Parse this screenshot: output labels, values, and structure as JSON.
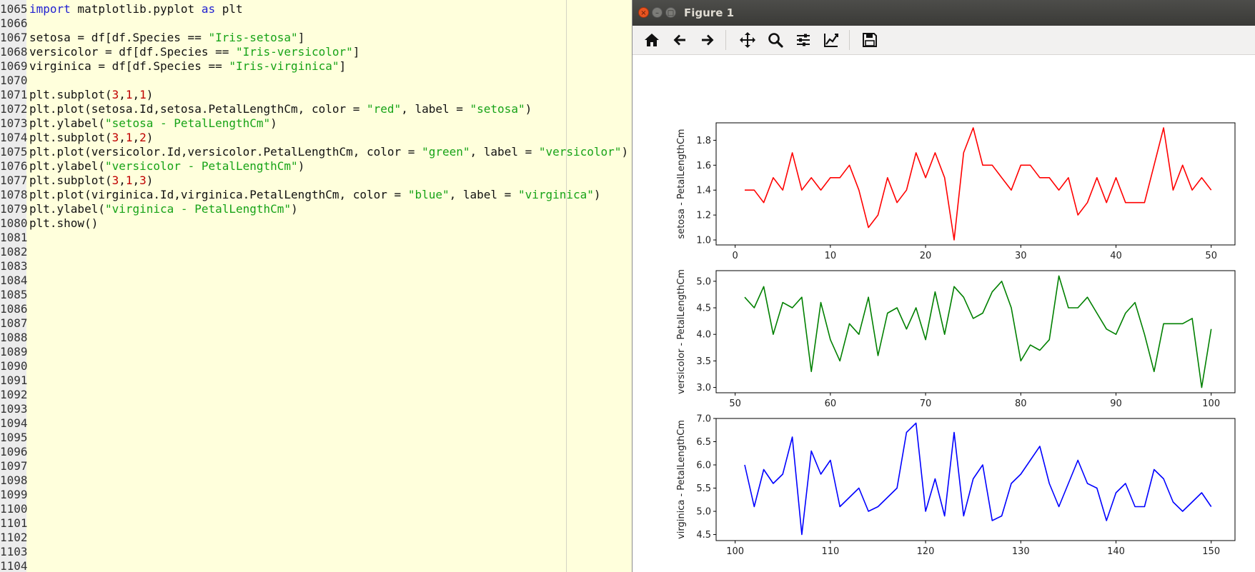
{
  "editor": {
    "lines": [
      {
        "n": "1065",
        "tokens": [
          {
            "t": "import",
            "c": "kw"
          },
          {
            "t": " matplotlib.pyplot "
          },
          {
            "t": "as",
            "c": "kw"
          },
          {
            "t": " plt"
          }
        ]
      },
      {
        "n": "1066",
        "tokens": []
      },
      {
        "n": "1067",
        "tokens": [
          {
            "t": "setosa = df[df.Species == "
          },
          {
            "t": "\"Iris-setosa\"",
            "c": "str"
          },
          {
            "t": "]"
          }
        ]
      },
      {
        "n": "1068",
        "tokens": [
          {
            "t": "versicolor = df[df.Species == "
          },
          {
            "t": "\"Iris-versicolor\"",
            "c": "str"
          },
          {
            "t": "]"
          }
        ]
      },
      {
        "n": "1069",
        "tokens": [
          {
            "t": "virginica = df[df.Species == "
          },
          {
            "t": "\"Iris-virginica\"",
            "c": "str"
          },
          {
            "t": "]"
          }
        ]
      },
      {
        "n": "1070",
        "tokens": []
      },
      {
        "n": "1071",
        "tokens": [
          {
            "t": "plt.subplot("
          },
          {
            "t": "3",
            "c": "num"
          },
          {
            "t": ","
          },
          {
            "t": "1",
            "c": "num"
          },
          {
            "t": ","
          },
          {
            "t": "1",
            "c": "num"
          },
          {
            "t": ")"
          }
        ]
      },
      {
        "n": "1072",
        "tokens": [
          {
            "t": "plt.plot(setosa.Id,setosa.PetalLengthCm, color = "
          },
          {
            "t": "\"red\"",
            "c": "str"
          },
          {
            "t": ", label = "
          },
          {
            "t": "\"setosa\"",
            "c": "str"
          },
          {
            "t": ")"
          }
        ]
      },
      {
        "n": "1073",
        "tokens": [
          {
            "t": "plt.ylabel("
          },
          {
            "t": "\"setosa - PetalLengthCm\"",
            "c": "str"
          },
          {
            "t": ")"
          }
        ]
      },
      {
        "n": "1074",
        "tokens": [
          {
            "t": "plt.subplot("
          },
          {
            "t": "3",
            "c": "num"
          },
          {
            "t": ","
          },
          {
            "t": "1",
            "c": "num"
          },
          {
            "t": ","
          },
          {
            "t": "2",
            "c": "num"
          },
          {
            "t": ")"
          }
        ]
      },
      {
        "n": "1075",
        "tokens": [
          {
            "t": "plt.plot(versicolor.Id,versicolor.PetalLengthCm, color = "
          },
          {
            "t": "\"green\"",
            "c": "str"
          },
          {
            "t": ", label = "
          },
          {
            "t": "\"versicolor\"",
            "c": "str"
          },
          {
            "t": ")"
          }
        ]
      },
      {
        "n": "1076",
        "tokens": [
          {
            "t": "plt.ylabel("
          },
          {
            "t": "\"versicolor - PetalLengthCm\"",
            "c": "str"
          },
          {
            "t": ")"
          }
        ]
      },
      {
        "n": "1077",
        "tokens": [
          {
            "t": "plt.subplot("
          },
          {
            "t": "3",
            "c": "num"
          },
          {
            "t": ","
          },
          {
            "t": "1",
            "c": "num"
          },
          {
            "t": ","
          },
          {
            "t": "3",
            "c": "num"
          },
          {
            "t": ")"
          }
        ]
      },
      {
        "n": "1078",
        "tokens": [
          {
            "t": "plt.plot(virginica.Id,virginica.PetalLengthCm, color = "
          },
          {
            "t": "\"blue\"",
            "c": "str"
          },
          {
            "t": ", label = "
          },
          {
            "t": "\"virginica\"",
            "c": "str"
          },
          {
            "t": ")"
          }
        ]
      },
      {
        "n": "1079",
        "tokens": [
          {
            "t": "plt.ylabel("
          },
          {
            "t": "\"virginica - PetalLengthCm\"",
            "c": "str"
          },
          {
            "t": ")"
          }
        ]
      },
      {
        "n": "1080",
        "tokens": [
          {
            "t": "plt.show()"
          }
        ]
      },
      {
        "n": "1081",
        "tokens": []
      },
      {
        "n": "1082",
        "tokens": []
      },
      {
        "n": "1083",
        "tokens": []
      },
      {
        "n": "1084",
        "tokens": []
      },
      {
        "n": "1085",
        "tokens": []
      },
      {
        "n": "1086",
        "tokens": []
      },
      {
        "n": "1087",
        "tokens": []
      },
      {
        "n": "1088",
        "tokens": []
      },
      {
        "n": "1089",
        "tokens": []
      },
      {
        "n": "1090",
        "tokens": []
      },
      {
        "n": "1091",
        "tokens": []
      },
      {
        "n": "1092",
        "tokens": []
      },
      {
        "n": "1093",
        "tokens": []
      },
      {
        "n": "1094",
        "tokens": []
      },
      {
        "n": "1095",
        "tokens": []
      },
      {
        "n": "1096",
        "tokens": []
      },
      {
        "n": "1097",
        "tokens": []
      },
      {
        "n": "1098",
        "tokens": []
      },
      {
        "n": "1099",
        "tokens": []
      },
      {
        "n": "1100",
        "tokens": []
      },
      {
        "n": "1101",
        "tokens": []
      },
      {
        "n": "1102",
        "tokens": []
      },
      {
        "n": "1103",
        "tokens": []
      },
      {
        "n": "1104",
        "tokens": []
      }
    ]
  },
  "window": {
    "title": "Figure 1",
    "controls": {
      "close": "×",
      "minimize": "–",
      "maximize": "□"
    }
  },
  "toolbar": {
    "icons": [
      "home-icon",
      "back-arrow-icon",
      "forward-arrow-icon",
      "move-icon",
      "zoom-icon",
      "subplots-config-icon",
      "axes-edit-icon",
      "save-icon"
    ]
  },
  "colors": {
    "setosa": "#ff0000",
    "versicolor": "#008000",
    "virginica": "#0000ff"
  },
  "chart_data": [
    {
      "type": "line",
      "ylabel": "setosa - PetalLengthCm",
      "color": "#ff0000",
      "x_start": 1,
      "xlim": [
        -2,
        52.5
      ],
      "ylim": [
        0.96,
        1.94
      ],
      "xticks": [
        0,
        10,
        20,
        30,
        40,
        50
      ],
      "yticks": [
        1.0,
        1.2,
        1.4,
        1.6,
        1.8
      ],
      "ytick_labels": [
        "1.0",
        "1.2",
        "1.4",
        "1.6",
        "1.8"
      ],
      "values": [
        1.4,
        1.4,
        1.3,
        1.5,
        1.4,
        1.7,
        1.4,
        1.5,
        1.4,
        1.5,
        1.5,
        1.6,
        1.4,
        1.1,
        1.2,
        1.5,
        1.3,
        1.4,
        1.7,
        1.5,
        1.7,
        1.5,
        1.0,
        1.7,
        1.9,
        1.6,
        1.6,
        1.5,
        1.4,
        1.6,
        1.6,
        1.5,
        1.5,
        1.4,
        1.5,
        1.2,
        1.3,
        1.5,
        1.3,
        1.5,
        1.3,
        1.3,
        1.3,
        1.6,
        1.9,
        1.4,
        1.6,
        1.4,
        1.5,
        1.4
      ]
    },
    {
      "type": "line",
      "ylabel": "versicolor - PetalLengthCm",
      "color": "#008000",
      "x_start": 51,
      "xlim": [
        48,
        102.5
      ],
      "ylim": [
        2.9,
        5.2
      ],
      "xticks": [
        50,
        60,
        70,
        80,
        90,
        100
      ],
      "yticks": [
        3.0,
        3.5,
        4.0,
        4.5,
        5.0
      ],
      "ytick_labels": [
        "3.0",
        "3.5",
        "4.0",
        "4.5",
        "5.0"
      ],
      "values": [
        4.7,
        4.5,
        4.9,
        4.0,
        4.6,
        4.5,
        4.7,
        3.3,
        4.6,
        3.9,
        3.5,
        4.2,
        4.0,
        4.7,
        3.6,
        4.4,
        4.5,
        4.1,
        4.5,
        3.9,
        4.8,
        4.0,
        4.9,
        4.7,
        4.3,
        4.4,
        4.8,
        5.0,
        4.5,
        3.5,
        3.8,
        3.7,
        3.9,
        5.1,
        4.5,
        4.5,
        4.7,
        4.4,
        4.1,
        4.0,
        4.4,
        4.6,
        4.0,
        3.3,
        4.2,
        4.2,
        4.2,
        4.3,
        3.0,
        4.1
      ]
    },
    {
      "type": "line",
      "ylabel": "virginica - PetalLengthCm",
      "color": "#0000ff",
      "x_start": 101,
      "xlim": [
        98,
        152.5
      ],
      "ylim": [
        4.37,
        7.0
      ],
      "xticks": [
        100,
        110,
        120,
        130,
        140,
        150
      ],
      "yticks": [
        4.5,
        5.0,
        5.5,
        6.0,
        6.5,
        7.0
      ],
      "ytick_labels": [
        "4.5",
        "5.0",
        "5.5",
        "6.0",
        "6.5",
        "7.0"
      ],
      "values": [
        6.0,
        5.1,
        5.9,
        5.6,
        5.8,
        6.6,
        4.5,
        6.3,
        5.8,
        6.1,
        5.1,
        5.3,
        5.5,
        5.0,
        5.1,
        5.3,
        5.5,
        6.7,
        6.9,
        5.0,
        5.7,
        4.9,
        6.7,
        4.9,
        5.7,
        6.0,
        4.8,
        4.9,
        5.6,
        5.8,
        6.1,
        6.4,
        5.6,
        5.1,
        5.6,
        6.1,
        5.6,
        5.5,
        4.8,
        5.4,
        5.6,
        5.1,
        5.1,
        5.9,
        5.7,
        5.2,
        5.0,
        5.2,
        5.4,
        5.1
      ]
    }
  ]
}
